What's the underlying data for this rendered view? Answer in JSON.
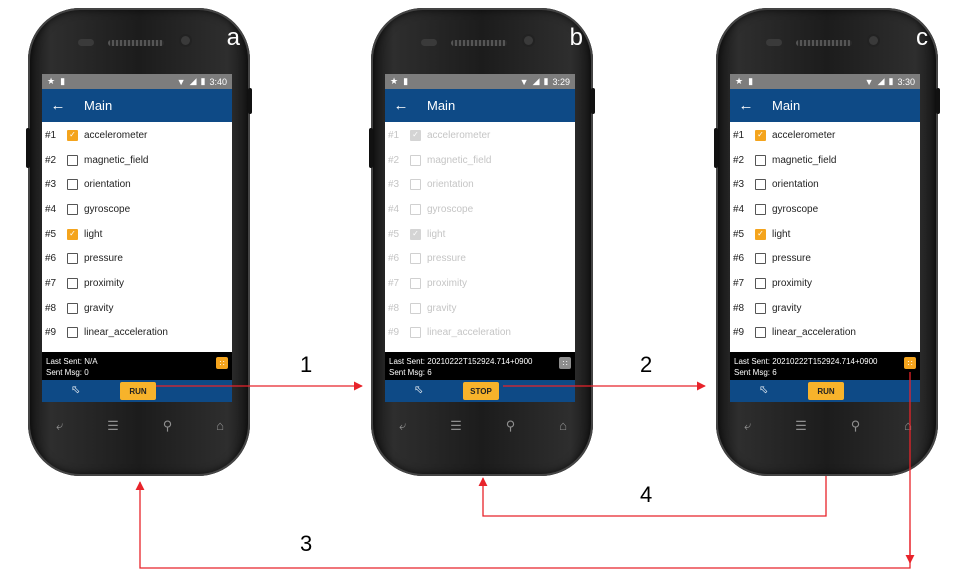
{
  "accent_color": "#f4a41d",
  "appbar_color": "#0e4a86",
  "arrow_color": "#e8232a",
  "arrow_labels": [
    "1",
    "2",
    "3",
    "4"
  ],
  "phones": [
    {
      "letter": "a",
      "time": "3:40",
      "title": "Main",
      "disabled": false,
      "sensors": [
        {
          "num": "#1",
          "name": "accelerometer",
          "checked": true
        },
        {
          "num": "#2",
          "name": "magnetic_field",
          "checked": false
        },
        {
          "num": "#3",
          "name": "orientation",
          "checked": false
        },
        {
          "num": "#4",
          "name": "gyroscope",
          "checked": false
        },
        {
          "num": "#5",
          "name": "light",
          "checked": true
        },
        {
          "num": "#6",
          "name": "pressure",
          "checked": false
        },
        {
          "num": "#7",
          "name": "proximity",
          "checked": false
        },
        {
          "num": "#8",
          "name": "gravity",
          "checked": false
        },
        {
          "num": "#9",
          "name": "linear_acceleration",
          "checked": false
        }
      ],
      "last_sent": "Last Sent: N/A",
      "sent_msg": "Sent Msg: 0",
      "button": "RUN",
      "mini_button_active": true
    },
    {
      "letter": "b",
      "time": "3:29",
      "title": "Main",
      "disabled": true,
      "sensors": [
        {
          "num": "#1",
          "name": "accelerometer",
          "checked": true
        },
        {
          "num": "#2",
          "name": "magnetic_field",
          "checked": false
        },
        {
          "num": "#3",
          "name": "orientation",
          "checked": false
        },
        {
          "num": "#4",
          "name": "gyroscope",
          "checked": false
        },
        {
          "num": "#5",
          "name": "light",
          "checked": true
        },
        {
          "num": "#6",
          "name": "pressure",
          "checked": false
        },
        {
          "num": "#7",
          "name": "proximity",
          "checked": false
        },
        {
          "num": "#8",
          "name": "gravity",
          "checked": false
        },
        {
          "num": "#9",
          "name": "linear_acceleration",
          "checked": false
        }
      ],
      "last_sent": "Last Sent: 20210222T152924.714+0900",
      "sent_msg": "Sent Msg: 6",
      "button": "STOP",
      "mini_button_active": false
    },
    {
      "letter": "c",
      "time": "3:30",
      "title": "Main",
      "disabled": false,
      "sensors": [
        {
          "num": "#1",
          "name": "accelerometer",
          "checked": true
        },
        {
          "num": "#2",
          "name": "magnetic_field",
          "checked": false
        },
        {
          "num": "#3",
          "name": "orientation",
          "checked": false
        },
        {
          "num": "#4",
          "name": "gyroscope",
          "checked": false
        },
        {
          "num": "#5",
          "name": "light",
          "checked": true
        },
        {
          "num": "#6",
          "name": "pressure",
          "checked": false
        },
        {
          "num": "#7",
          "name": "proximity",
          "checked": false
        },
        {
          "num": "#8",
          "name": "gravity",
          "checked": false
        },
        {
          "num": "#9",
          "name": "linear_acceleration",
          "checked": false
        }
      ],
      "last_sent": "Last Sent: 20210222T152924.714+0900",
      "sent_msg": "Sent Msg: 6",
      "button": "RUN",
      "mini_button_active": true
    }
  ]
}
